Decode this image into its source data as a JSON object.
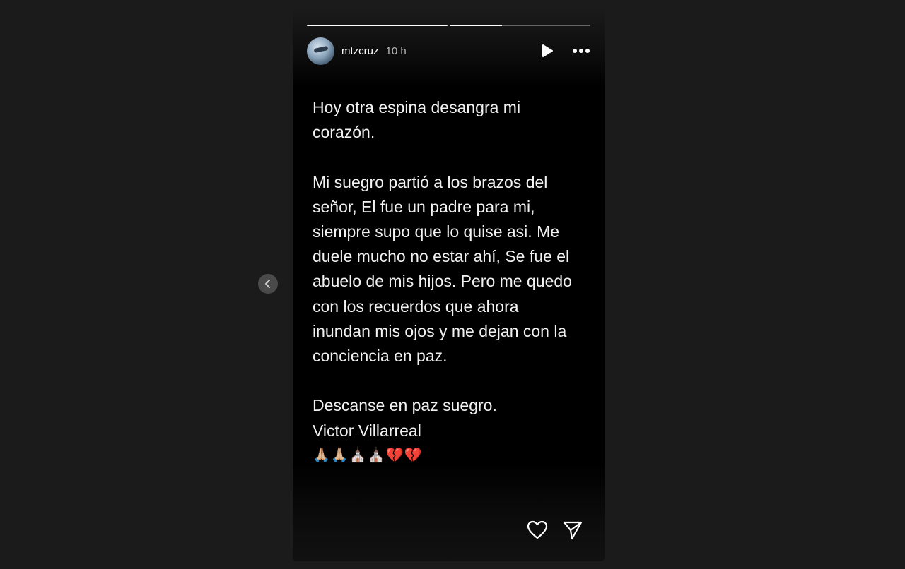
{
  "viewer": {
    "prev_icon": "chevron-left-icon"
  },
  "story": {
    "progress": [
      1.0,
      0.37
    ],
    "user": {
      "username": "mtzcruz",
      "time": "10 h"
    },
    "controls": {
      "play_icon": "play-icon",
      "more_icon": "more-options-icon"
    },
    "text": "Hoy otra espina desangra mi\ncorazón.\n\nMi suegro partió a los brazos del\nseñor, El fue un padre para mi,\nsiempre supo que lo quise asi. Me\nduele mucho no estar ahí, Se fue el\nabuelo de mis hijos. Pero me quedo\ncon los recuerdos que ahora\ninundan mis ojos y me dejan con la\nconciencia en paz.\n\nDescanse en paz suegro.\nVictor Villarreal",
    "emojis": "🙏🏼🙏🏼⛪⛪💔💔",
    "footer": {
      "like_icon": "heart-icon",
      "share_icon": "send-icon"
    }
  }
}
